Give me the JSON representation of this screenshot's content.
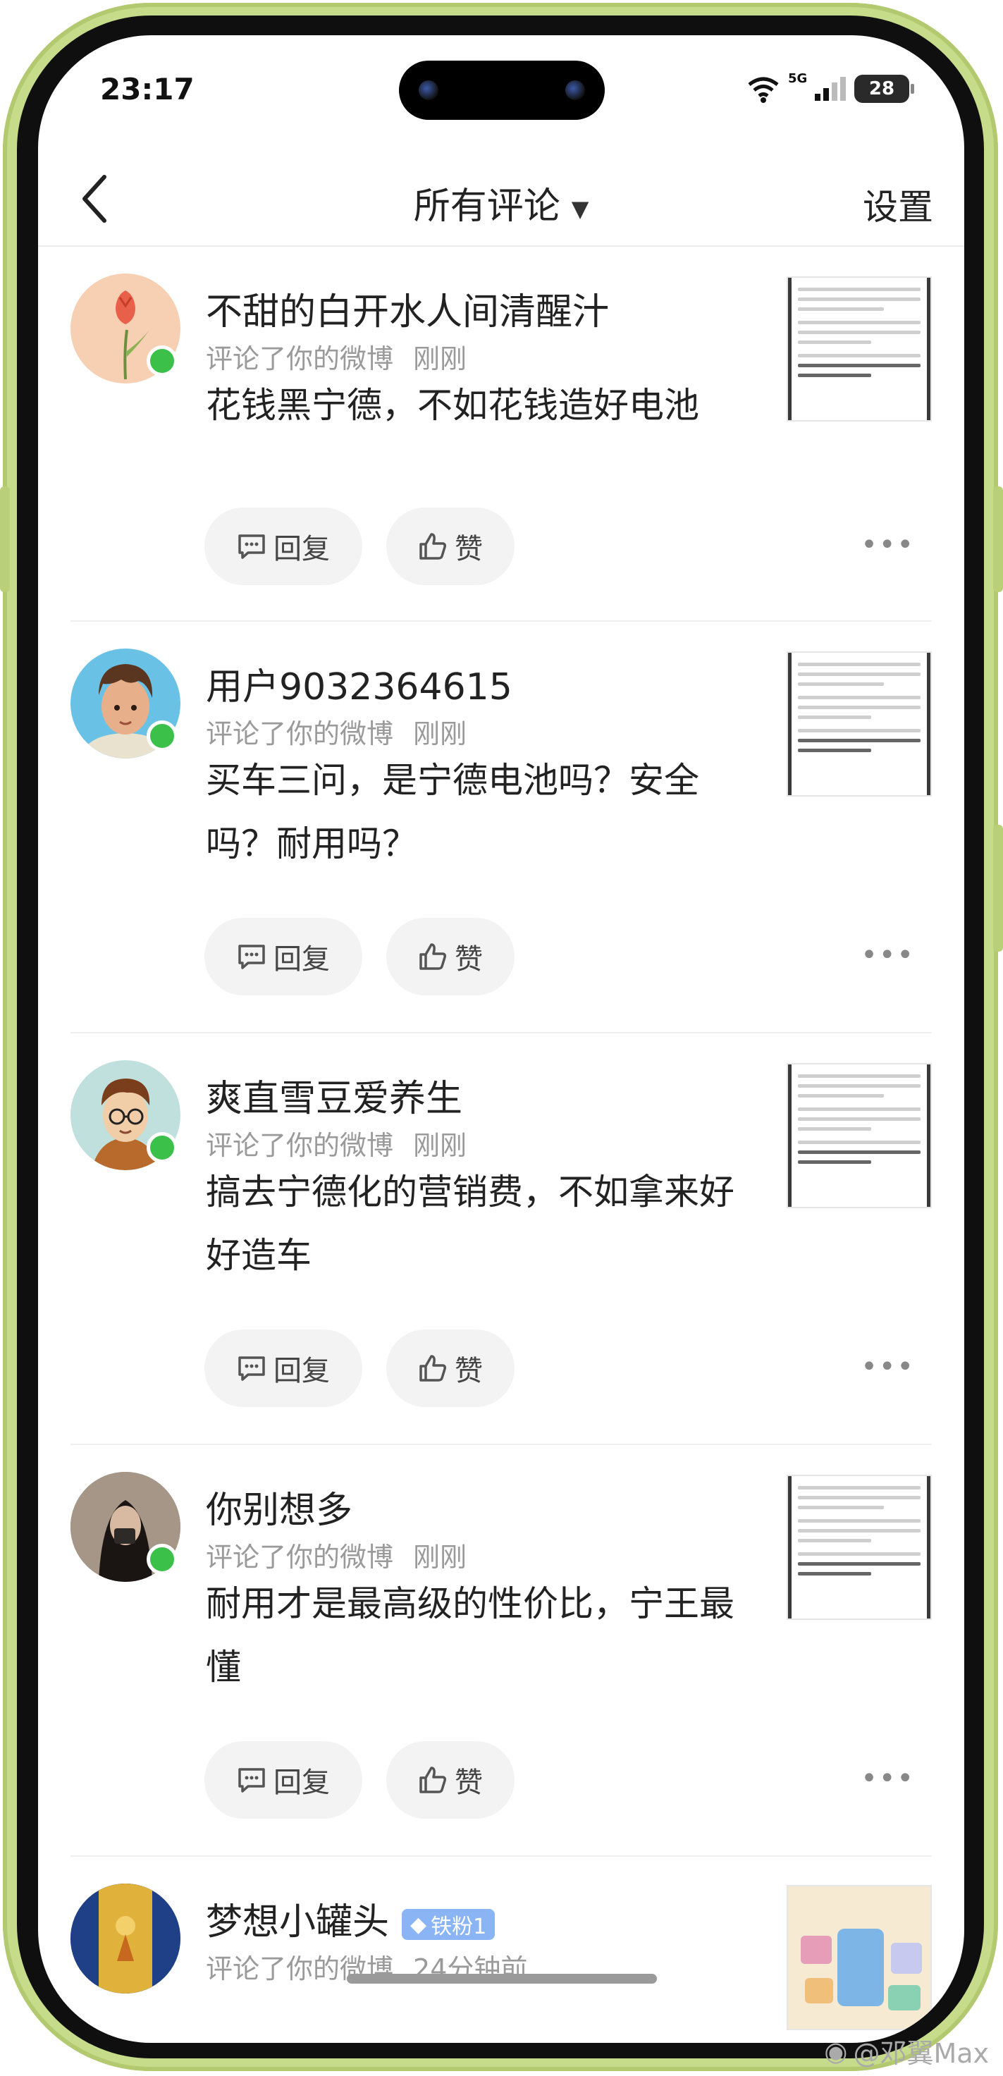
{
  "status_bar": {
    "time": "23:17",
    "network": "5G",
    "battery": "28"
  },
  "nav": {
    "title": "所有评论",
    "settings": "设置"
  },
  "actions": {
    "reply": "回复",
    "like": "赞"
  },
  "comments": [
    {
      "username": "不甜的白开水人间清醒汁",
      "action": "评论了你的微博",
      "time": "刚刚",
      "text": "花钱黑宁德，不如花钱造好电池",
      "online": true
    },
    {
      "username": "用户9032364615",
      "action": "评论了你的微博",
      "time": "刚刚",
      "text": "买车三问，是宁德电池吗？安全吗？耐用吗？",
      "online": true
    },
    {
      "username": "爽直雪豆爱养生",
      "action": "评论了你的微博",
      "time": "刚刚",
      "text": "搞去宁德化的营销费，不如拿来好好造车",
      "online": true
    },
    {
      "username": "你别想多",
      "action": "评论了你的微博",
      "time": "刚刚",
      "text": "耐用才是最高级的性价比，宁王最懂",
      "online": true
    },
    {
      "username": "梦想小罐头",
      "badge": "铁粉1",
      "action": "评论了你的微博",
      "time": "24分钟前",
      "online": false
    }
  ],
  "watermark": "@邓翼Max",
  "colors": {
    "frame": "#c6dc8a",
    "online": "#3bc14a",
    "badge": "#8ab4f3"
  }
}
